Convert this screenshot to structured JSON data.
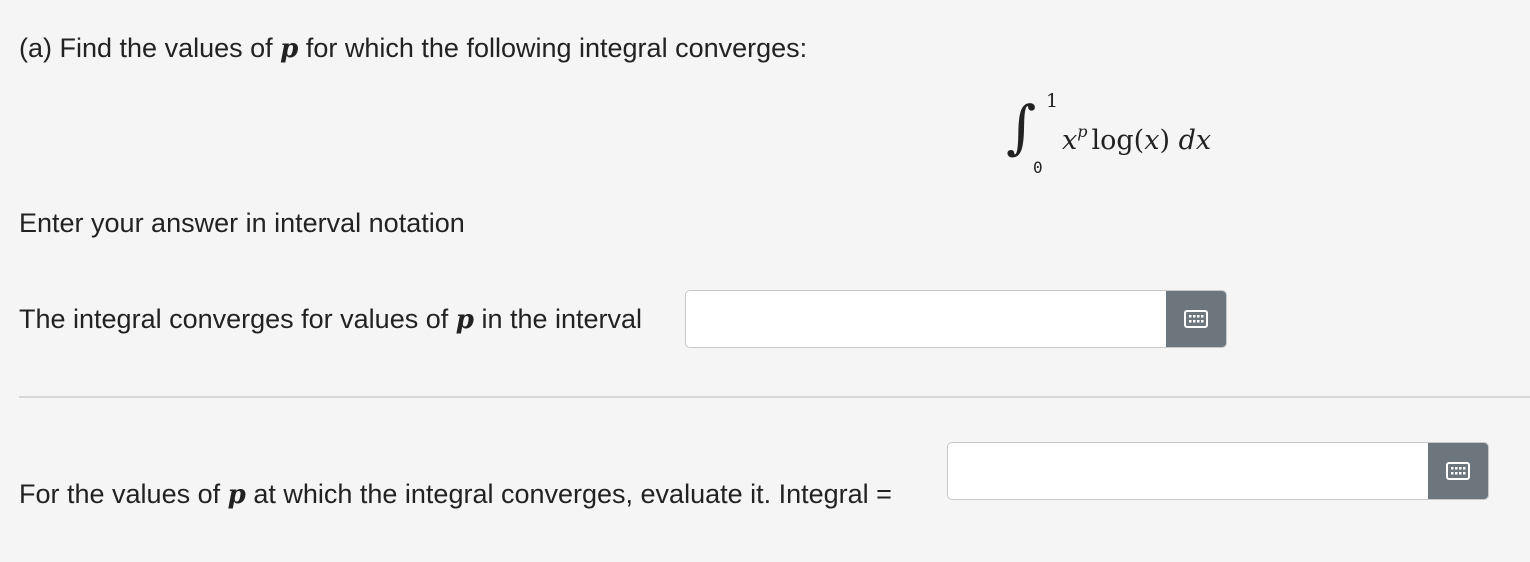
{
  "question": {
    "part_label": "(a)",
    "prompt_before_var": "Find the values of",
    "variable": "p",
    "prompt_after_var": "for which the following integral converges:",
    "integral": {
      "lower": "0",
      "upper": "1",
      "base": "x",
      "exponent": "p",
      "function": "log(",
      "arg": "x",
      "close": ")",
      "d": "d",
      "dvar": "x"
    },
    "instruction": "Enter your answer in interval notation"
  },
  "answer1": {
    "label_before_var": "The integral converges for values of",
    "variable": "p",
    "label_after_var": "in the interval",
    "value": "",
    "keyboard_icon": "keyboard-icon"
  },
  "answer2": {
    "label_before_var": "For the values of",
    "variable": "p",
    "label_after_var": "at which the integral converges, evaluate it. Integral =",
    "value": "",
    "keyboard_icon": "keyboard-icon"
  }
}
